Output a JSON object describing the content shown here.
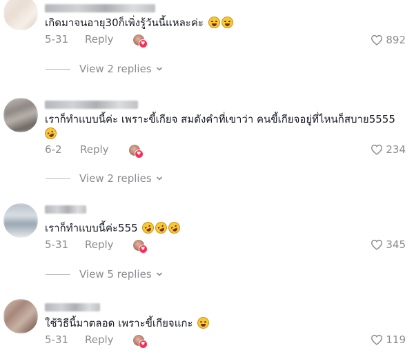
{
  "comments": [
    {
      "text": "เกิดมาจนอายุ30ก็เพิ่งรู้วันนี้แหละค่ะ",
      "emojis": [
        "grinning-sweat-emoji",
        "grinning-sweat-emoji"
      ],
      "date": "5-31",
      "reply_label": "Reply",
      "likes": "892",
      "view_replies": "View 2 replies"
    },
    {
      "text": "เราก็ทำแบบนี้ค่ะ เพราะขี้เกียจ สมดังคำที่เขาว่า คนขี้เกียจอยู่ที่ไหนก็สบาย5555",
      "emojis": [
        "rolling-laughing-emoji"
      ],
      "date": "6-2",
      "reply_label": "Reply",
      "likes": "234",
      "view_replies": "View 2 replies"
    },
    {
      "text": "เราก็ทำแบบนี้ค่ะ555",
      "emojis": [
        "rolling-laughing-emoji",
        "rolling-laughing-emoji",
        "rolling-laughing-emoji"
      ],
      "date": "5-31",
      "reply_label": "Reply",
      "likes": "345",
      "view_replies": "View 5 replies"
    },
    {
      "text": "ใช้วิธีนี้มาตลอด เพราะขี้เกียจแกะ",
      "emojis": [
        "grinning-sweat-emoji"
      ],
      "date": "5-31",
      "reply_label": "Reply",
      "likes": "119"
    }
  ],
  "icons": {
    "like": "heart-outline-icon",
    "creator_liked": "creator-liked-badge-icon",
    "chevron": "chevron-down-icon"
  },
  "colors": {
    "text": "#161823",
    "secondary": "#8a8b91",
    "creator_heart": "#fe2c55"
  }
}
